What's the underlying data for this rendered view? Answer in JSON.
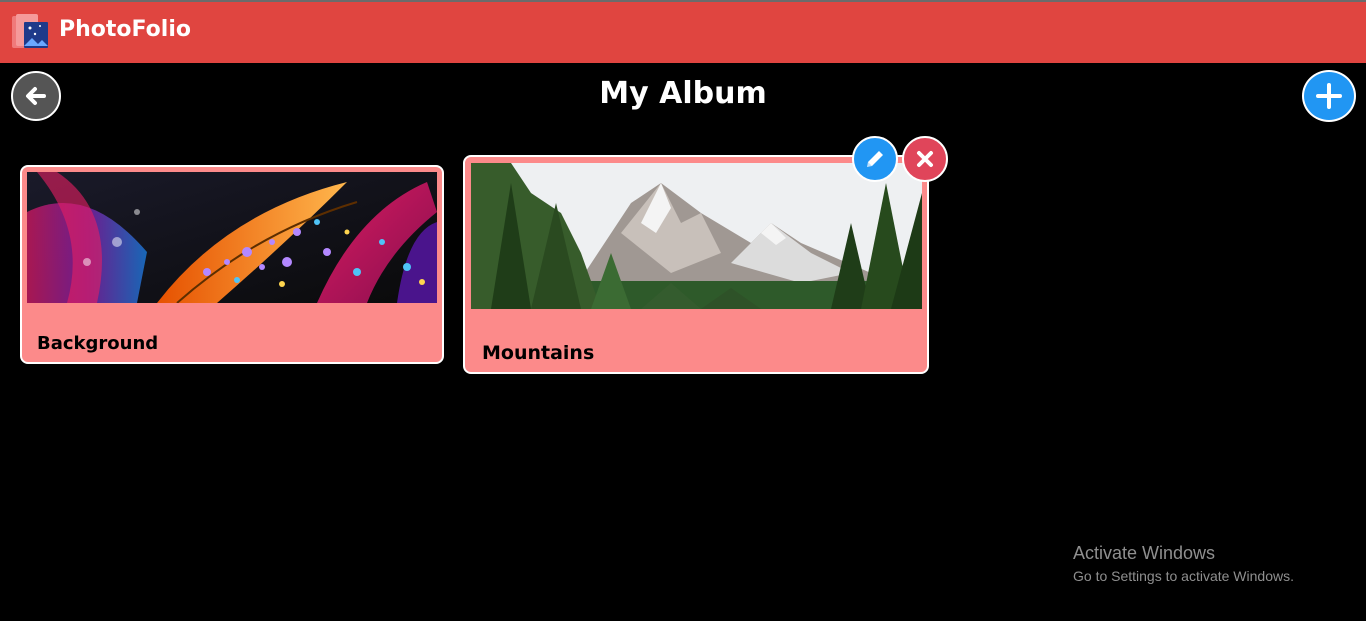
{
  "app": {
    "brand": "PhotoFolio"
  },
  "page": {
    "title": "My Album"
  },
  "albums": [
    {
      "label": "Background",
      "icon": "feather-droplets-image"
    },
    {
      "label": "Mountains",
      "icon": "mountain-landscape-image"
    }
  ],
  "actions": {
    "back": "arrow-left-icon",
    "add": "plus-icon",
    "edit": "pencil-icon",
    "delete": "close-icon"
  },
  "watermark": {
    "line1": "Activate Windows",
    "line2": "Go to Settings to activate Windows."
  },
  "colors": {
    "navbar": "#e04540",
    "card": "#fc8a8a",
    "accent_blue": "#2196f3",
    "delete_red": "#e0455a"
  }
}
